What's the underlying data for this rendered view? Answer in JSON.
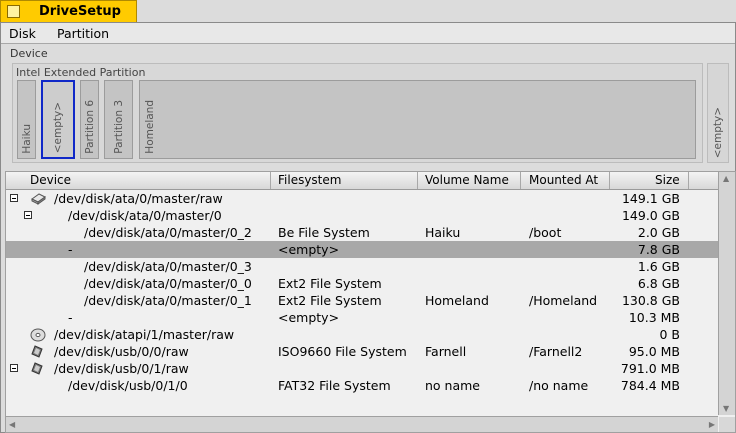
{
  "window": {
    "title": "DriveSetup"
  },
  "menu": [
    "Disk",
    "Partition"
  ],
  "device_map": {
    "label": "Device",
    "extended_label": "Intel Extended Partition",
    "segments": [
      "Haiku",
      "<empty>",
      "Partition 6",
      "Partition 3",
      "Homeland"
    ],
    "right_segment": "<empty>"
  },
  "table": {
    "columns": [
      "Device",
      "Filesystem",
      "Volume Name",
      "Mounted At",
      "Size"
    ],
    "rows": [
      {
        "device": "/dev/disk/ata/0/master/raw",
        "filesystem": "",
        "volume": "",
        "mounted": "",
        "size": "149.1 GB",
        "icon": "hard-disk-icon",
        "expander": true
      },
      {
        "device": "/dev/disk/ata/0/master/0",
        "filesystem": "",
        "volume": "",
        "mounted": "",
        "size": "149.0 GB",
        "expander": true
      },
      {
        "device": "/dev/disk/ata/0/master/0_2",
        "filesystem": "Be File System",
        "volume": "Haiku",
        "mounted": "/boot",
        "size": "2.0 GB"
      },
      {
        "device": "-",
        "filesystem": "<empty>",
        "volume": "",
        "mounted": "",
        "size": "7.8 GB",
        "selected": true
      },
      {
        "device": "/dev/disk/ata/0/master/0_3",
        "filesystem": "",
        "volume": "",
        "mounted": "",
        "size": "1.6 GB"
      },
      {
        "device": "/dev/disk/ata/0/master/0_0",
        "filesystem": "Ext2 File System",
        "volume": "",
        "mounted": "",
        "size": "6.8 GB"
      },
      {
        "device": "/dev/disk/ata/0/master/0_1",
        "filesystem": "Ext2 File System",
        "volume": "Homeland",
        "mounted": "/Homeland",
        "size": "130.8 GB"
      },
      {
        "device": "-",
        "filesystem": "<empty>",
        "volume": "",
        "mounted": "",
        "size": "10.3 MB"
      },
      {
        "device": "/dev/disk/atapi/1/master/raw",
        "filesystem": "",
        "volume": "",
        "mounted": "",
        "size": "0 B",
        "icon": "cd-icon"
      },
      {
        "device": "/dev/disk/usb/0/0/raw",
        "filesystem": "ISO9660 File System",
        "volume": "Farnell",
        "mounted": "/Farnell2",
        "size": "95.0 MB",
        "icon": "usb-drive-icon"
      },
      {
        "device": "/dev/disk/usb/0/1/raw",
        "filesystem": "",
        "volume": "",
        "mounted": "",
        "size": "791.0 MB",
        "icon": "usb-drive-icon",
        "expander": true
      },
      {
        "device": "/dev/disk/usb/0/1/0",
        "filesystem": "FAT32 File System",
        "volume": "no name",
        "mounted": "/no name",
        "size": "784.4 MB"
      }
    ]
  },
  "colors": {
    "tab": "#ffcb00",
    "selection_border": "#1028c8",
    "row_selected": "#a8a8a8"
  }
}
